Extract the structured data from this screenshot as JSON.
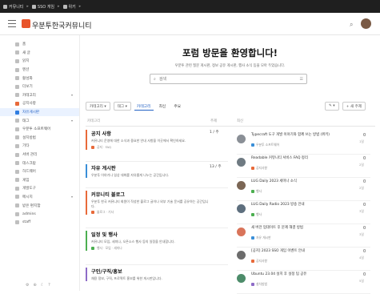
{
  "topbar": {
    "items": [
      "커뮤니티",
      "SSO 게임",
      "위키"
    ],
    "separator": "▸"
  },
  "header": {
    "brand": "우분투한국커뮤니티",
    "search_icon": "search-icon",
    "avatar_color": "#7a5a45",
    "logo_color": "#e8542b"
  },
  "sidebar": {
    "items": [
      {
        "label": "홈",
        "active": false
      },
      {
        "label": "새 글",
        "active": false
      },
      {
        "label": "읽지",
        "active": false
      },
      {
        "label": "멘션",
        "active": false
      },
      {
        "label": "활성화",
        "active": false
      },
      {
        "label": "더보기",
        "active": false
      },
      {
        "label": "카테고리",
        "active": false,
        "chevron": "▾"
      },
      {
        "label": "공지사항",
        "active": false,
        "highlight": true
      },
      {
        "label": "자유게시판",
        "active": true
      },
      {
        "label": "태그",
        "active": false,
        "chevron": "▾"
      },
      {
        "label": "우분투 소프트웨어",
        "active": false
      },
      {
        "label": "설치방법",
        "active": false
      },
      {
        "label": "기타",
        "active": false
      },
      {
        "label": "서버 관리",
        "active": false
      },
      {
        "label": "데스크탑",
        "active": false
      },
      {
        "label": "하드웨어",
        "active": false
      },
      {
        "label": "게임",
        "active": false
      },
      {
        "label": "개발도구",
        "active": false
      },
      {
        "label": "메시지",
        "active": false,
        "chevron": "▾"
      },
      {
        "label": "받은 편지함",
        "active": false
      },
      {
        "label": "admins",
        "active": false
      },
      {
        "label": "staff",
        "active": false
      }
    ],
    "footer": [
      "⚙",
      "⊕",
      "☾",
      "?"
    ]
  },
  "hero": {
    "title": "포럼 방문을 환영합니다!",
    "subtitle": "우분투 관련 질문 게시판, 정보 공유 게시판, 행사 소식 등을 모아 두었습니다.",
    "search_placeholder": "검색",
    "search_go": "☰"
  },
  "filters": {
    "dropdowns": [
      "카테고리 ▾",
      "태그 ▾"
    ],
    "tabs": [
      {
        "label": "카테고리",
        "active": true
      },
      {
        "label": "최신",
        "active": false
      },
      {
        "label": "주요",
        "active": false
      }
    ],
    "right_buttons": [
      "✎ ▾",
      "+ 새 주제"
    ]
  },
  "columns": {
    "categories": "카테고리",
    "topics_count": "주제",
    "latest": "최신"
  },
  "categories": [
    {
      "title": "공지 사항",
      "desc": "커뮤니티 운영에 대한 소식과 중요한 안내 사항을 이곳에서 확인하세요.",
      "meta": "공지 · FAQ",
      "count": "1 / 주",
      "color": "#e86a3a"
    },
    {
      "title": "자유 게시판",
      "desc": "우분투 이야기나 일상 대화를 자유롭게 나누는 공간입니다.",
      "meta": "",
      "count": "13 / 주",
      "color": "#3a8fd8"
    },
    {
      "title": "커뮤니티 블로그",
      "desc": "우분투 한국 커뮤니티 회원이 작성한 블로그 글이나 외부 기술 문서를 공유하는 공간입니다.",
      "meta": "블로그 · 기사",
      "count": "",
      "color": "#e86a3a"
    },
    {
      "title": "일정 및 행사",
      "desc": "커뮤니티 모임, 세미나, 오픈소스 행사 등의 일정을 안내합니다.",
      "meta": "행사 · 모임 · 세미나",
      "count": "",
      "color": "#4caf50"
    },
    {
      "title": "구인/구직/홍보",
      "desc": "채용 정보, 구직, 프로젝트 홍보를 위한 게시판입니다.",
      "meta": "",
      "count": "",
      "color": "#8e6cc7"
    }
  ],
  "topics": [
    {
      "title": "Typecraft 도구 개발 이야기와 함께 쓰는 방법 (위키)",
      "tag": "우분투 소프트웨어",
      "num": "0",
      "ago": "1일",
      "avatar": "#8a8f96",
      "tagcolor": "#3a8fd8"
    },
    {
      "title": "Readable 커뮤니티 서비스 FAQ 정리",
      "tag": "공지사항",
      "num": "0",
      "ago": "2일",
      "avatar": "#6f7a82",
      "tagcolor": "#e86a3a"
    },
    {
      "title": "LUG Daily 2023 세미나 소식",
      "tag": "행사",
      "num": "0",
      "ago": "2일",
      "avatar": "#7b6655",
      "tagcolor": "#4caf50"
    },
    {
      "title": "LUG Daily Radio 2023 방송 안내",
      "tag": "행사",
      "num": "0",
      "ago": "3일",
      "avatar": "#5e6f7e",
      "tagcolor": "#4caf50"
    },
    {
      "title": "새 버전 업데이트 후 문제 해결 방법",
      "tag": "자유 게시판",
      "num": "0",
      "ago": "3일",
      "avatar": "#d9745a",
      "tagcolor": "#3a8fd8"
    },
    {
      "title": "[공지] 2023 SSO 게임 이벤트 안내",
      "tag": "공지사항",
      "num": "0",
      "ago": "4일",
      "avatar": "#6c6c6c",
      "tagcolor": "#e86a3a"
    },
    {
      "title": "Ubuntu 23.04 설치 후 설정 팁 공유",
      "tag": "설치방법",
      "num": "0",
      "ago": "5일",
      "avatar": "#4d8c6a",
      "tagcolor": "#8e6cc7"
    }
  ]
}
